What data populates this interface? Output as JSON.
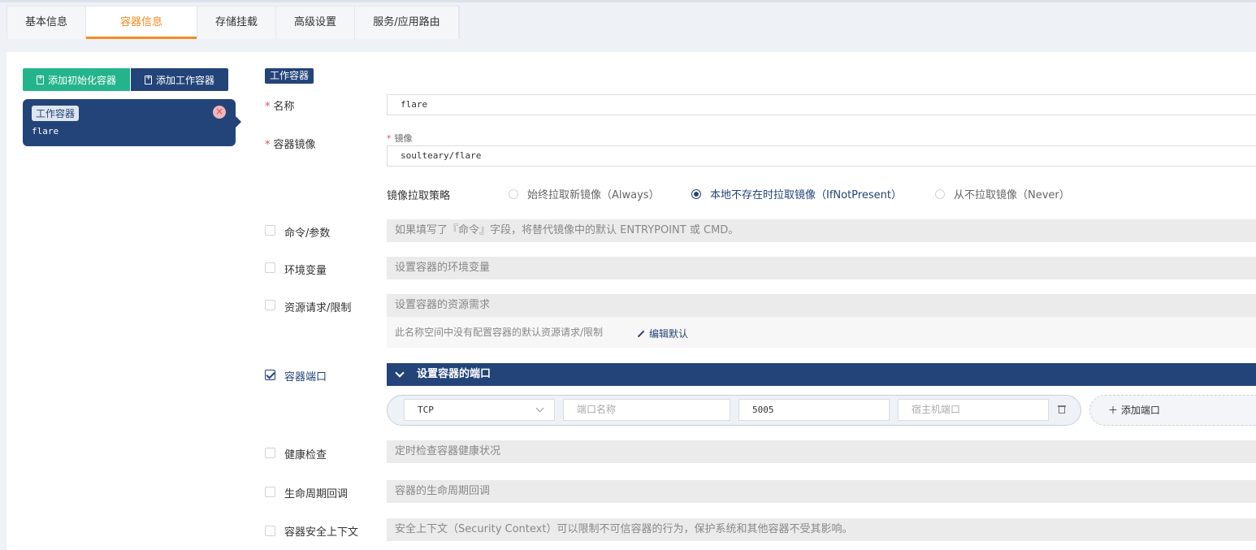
{
  "tabs": [
    {
      "label": "基本信息"
    },
    {
      "label": "容器信息"
    },
    {
      "label": "存储挂载"
    },
    {
      "label": "高级设置"
    },
    {
      "label": "服务/应用路由"
    }
  ],
  "toolbar": {
    "add_init": "添加初始化容器",
    "add_work": "添加工作容器"
  },
  "container_card": {
    "type_tag": "工作容器",
    "name": "flare"
  },
  "form": {
    "type_badge": "工作容器",
    "name_label": "名称",
    "name_value": "flare",
    "image_label": "容器镜像",
    "image_sublabel": "镜像",
    "image_value": "soulteary/flare",
    "pull_policy_label": "镜像拉取策略",
    "pull_options": [
      {
        "label": "始终拉取新镜像（Always）",
        "selected": false
      },
      {
        "label": "本地不存在时拉取镜像（IfNotPresent）",
        "selected": true
      },
      {
        "label": "从不拉取镜像（Never）",
        "selected": false
      }
    ],
    "sections": {
      "command": {
        "label": "命令/参数",
        "hint": "如果填写了『命令』字段，将替代镜像中的默认 ENTRYPOINT 或 CMD。"
      },
      "env": {
        "label": "环境变量",
        "hint": "设置容器的环境变量"
      },
      "resources": {
        "label": "资源请求/限制",
        "hint": "设置容器的资源需求",
        "note": "此名称空间中没有配置容器的默认资源请求/限制",
        "edit_link": "编辑默认"
      },
      "ports": {
        "label": "容器端口",
        "bar_title": "设置容器的端口"
      },
      "health": {
        "label": "健康检查",
        "hint": "定时检查容器健康状况"
      },
      "lifecycle": {
        "label": "生命周期回调",
        "hint": "容器的生命周期回调"
      },
      "security": {
        "label": "容器安全上下文",
        "hint": "安全上下文（Security Context）可以限制不可信容器的行为，保护系统和其他容器不受其影响。"
      }
    },
    "port_row": {
      "protocol": "TCP",
      "name_placeholder": "端口名称",
      "container_port": "5005",
      "host_port_placeholder": "宿主机端口"
    },
    "add_port": "添加端口"
  },
  "colors": {
    "accent": "#f08c24",
    "primary": "#234479",
    "green": "#24b48c"
  }
}
